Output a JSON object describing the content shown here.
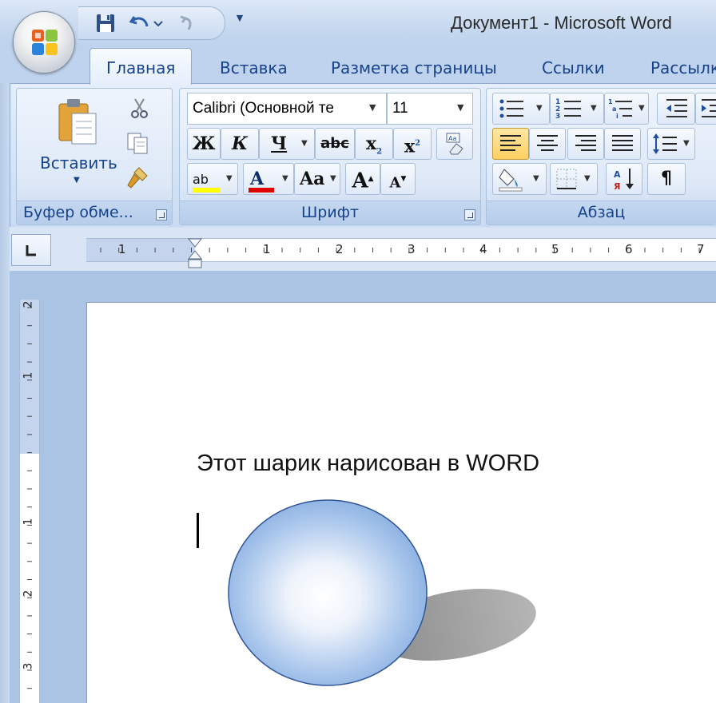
{
  "window": {
    "title": "Документ1 - Microsoft Word"
  },
  "quick_access": {
    "save": "save-icon",
    "undo": "undo-icon",
    "redo": "redo-icon"
  },
  "tabs": [
    {
      "label": "Главная",
      "active": true
    },
    {
      "label": "Вставка"
    },
    {
      "label": "Разметка страницы"
    },
    {
      "label": "Ссылки"
    },
    {
      "label": "Рассылк"
    }
  ],
  "clipboard": {
    "paste_label": "Вставить",
    "group_label": "Буфер обме..."
  },
  "font": {
    "name": "Calibri (Основной те",
    "size": "11",
    "bold": "Ж",
    "italic": "К",
    "underline": "Ч",
    "strike": "abc",
    "subscript": "x",
    "subscript_mark": "2",
    "superscript": "x",
    "superscript_mark": "2",
    "case": "Aa",
    "grow": "A",
    "shrink": "A",
    "highlight": "ab",
    "color_letter": "A",
    "group_label": "Шрифт"
  },
  "paragraph": {
    "group_label": "Абзац",
    "pilcrow": "¶"
  },
  "ruler": {
    "h_ticks": [
      "1",
      "1",
      "2",
      "3",
      "4",
      "5",
      "6",
      "7"
    ],
    "v_ticks": [
      "2",
      "1",
      "1",
      "2",
      "3"
    ]
  },
  "document": {
    "text": "Этот шарик нарисован в WORD"
  },
  "colors": {
    "accent": "#15428b",
    "ribbon": "#dde8f7",
    "ball_edge": "#2f5597",
    "ball_fill": "#8fb4e3",
    "shadow": "#a6a6a6"
  }
}
